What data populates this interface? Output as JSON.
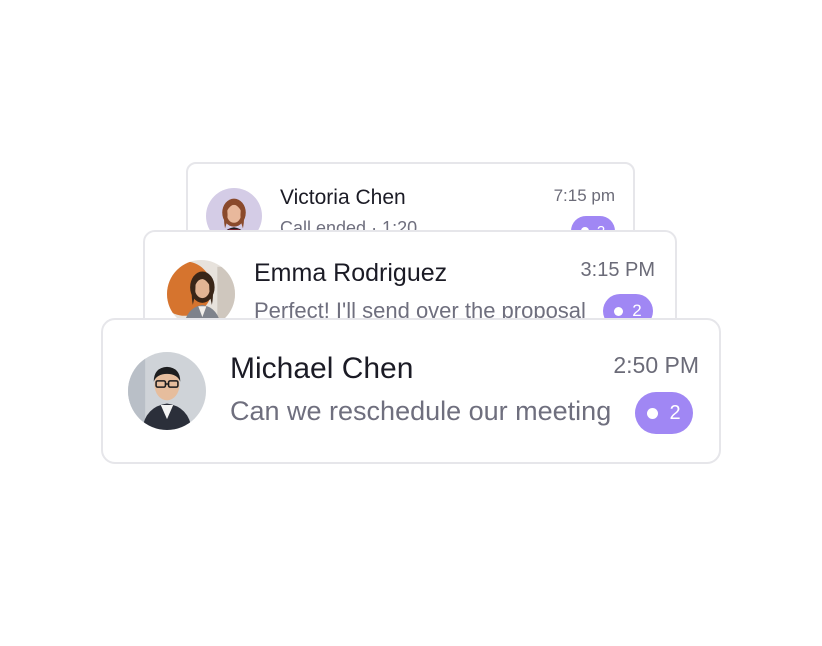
{
  "conversations": [
    {
      "name": "Victoria Chen",
      "preview": "Call ended · 1:20",
      "time": "7:15 pm",
      "unread_count": "2",
      "avatar": {
        "background": "#d4cce6",
        "hair": "#8a4a2c",
        "skin": "#e8b89c",
        "clothing": "#d62638"
      }
    },
    {
      "name": "Emma Rodriguez",
      "preview": "Perfect! I'll send over the proposal",
      "time": "3:15 PM",
      "unread_count": "2",
      "avatar": {
        "background": "#d6742e",
        "hair": "#3a2618",
        "skin": "#e3b594",
        "clothing": "#7f838c"
      }
    },
    {
      "name": "Michael Chen",
      "preview": "Can we reschedule our meeting",
      "time": "2:50 PM",
      "unread_count": "2",
      "avatar": {
        "background": "#cfd3d8",
        "hair": "#1d1d1f",
        "skin": "#e6bd9d",
        "clothing": "#2b2f3a"
      }
    }
  ],
  "colors": {
    "badge": "#a087f4",
    "card_border": "#e6e6ea",
    "name_text": "#1b1b25",
    "secondary_text": "#6f6f7e"
  }
}
